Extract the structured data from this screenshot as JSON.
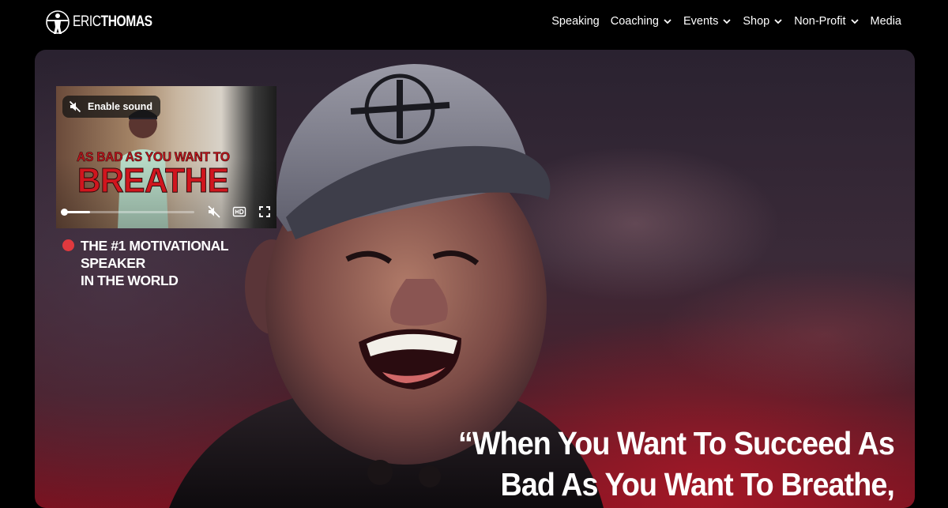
{
  "brand": {
    "logo_text_light": "ERIC",
    "logo_text_bold": "THOMAS",
    "logo_icon": "person-silhouette-icon"
  },
  "nav": {
    "items": [
      {
        "label": "Speaking",
        "has_dropdown": false
      },
      {
        "label": "Coaching",
        "has_dropdown": true
      },
      {
        "label": "Events",
        "has_dropdown": true
      },
      {
        "label": "Shop",
        "has_dropdown": true
      },
      {
        "label": "Non-Profit",
        "has_dropdown": true
      },
      {
        "label": "Media",
        "has_dropdown": false
      }
    ],
    "dropdown_icon": "chevron-down-icon"
  },
  "video": {
    "sound_button_label": "Enable sound",
    "sound_icon": "speaker-muted-icon",
    "title_line1": "AS BAD AS YOU WANT TO",
    "title_line2": "BREATHE",
    "progress": 0.2,
    "controls": [
      "mute-icon",
      "hd-icon",
      "fullscreen-icon"
    ],
    "title_color": "#d0161e"
  },
  "hero": {
    "tagline": [
      "THE #1 MOTIVATIONAL",
      "SPEAKER",
      "IN THE WORLD"
    ],
    "live_dot_color": "#e0393e",
    "quote_lines": [
      "“When You Want To Succeed As",
      "Bad As You Want To Breathe,"
    ]
  }
}
